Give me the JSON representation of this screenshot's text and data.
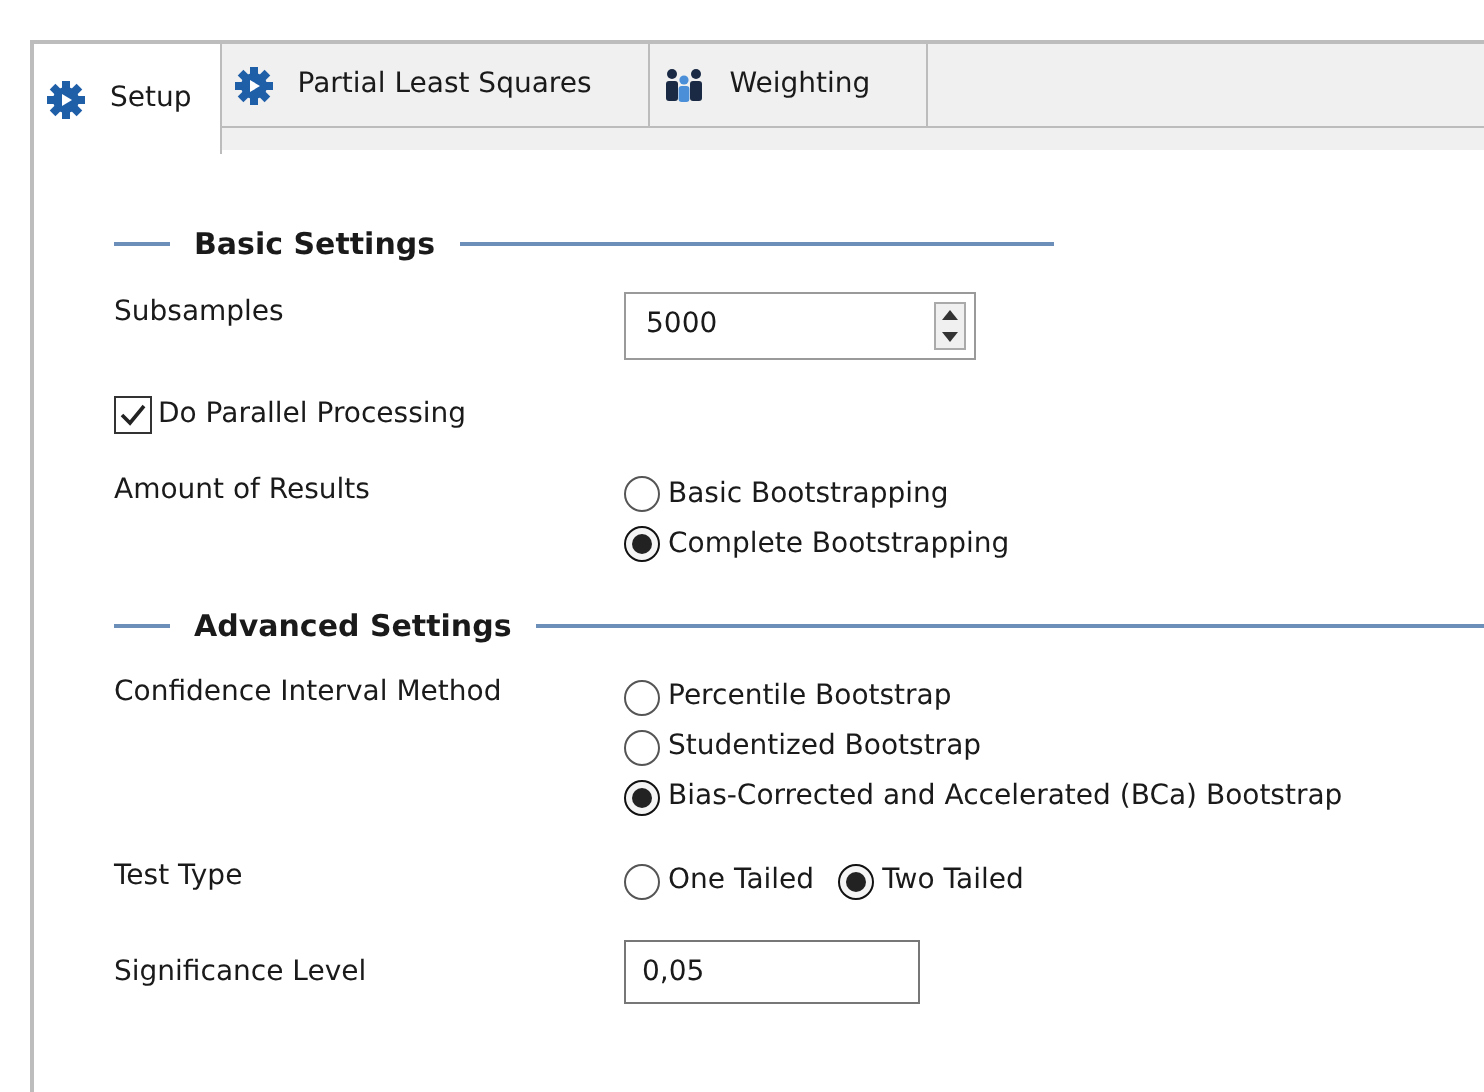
{
  "tabs": [
    {
      "label": "Setup",
      "selected": true,
      "kind": "gear"
    },
    {
      "label": "Partial Least Squares",
      "selected": false,
      "kind": "gear"
    },
    {
      "label": "Weighting",
      "selected": false,
      "kind": "people"
    }
  ],
  "sections": [
    {
      "title": "Basic Settings",
      "wide": false,
      "fields": [
        {
          "kind": "spinner",
          "label": "Subsamples",
          "value": "5000"
        },
        {
          "kind": "checkbox",
          "label": "Do Parallel Processing",
          "checked": true
        },
        {
          "kind": "radiocolumn",
          "label": "Amount of Results",
          "options": [
            {
              "label": "Basic Bootstrapping",
              "selected": false
            },
            {
              "label": "Complete Bootstrapping",
              "selected": true
            }
          ]
        }
      ]
    },
    {
      "title": "Advanced Settings",
      "wide": true,
      "fields": [
        {
          "kind": "radiocolumn",
          "label": "Confidence Interval Method",
          "options": [
            {
              "label": "Percentile Bootstrap",
              "selected": false
            },
            {
              "label": "Studentized Bootstrap",
              "selected": false
            },
            {
              "label": "Bias-Corrected and Accelerated (BCa) Bootstrap",
              "selected": true
            }
          ]
        },
        {
          "kind": "radiorow",
          "label": "Test Type",
          "options": [
            {
              "label": "One Tailed",
              "selected": false
            },
            {
              "label": "Two Tailed",
              "selected": true
            }
          ]
        },
        {
          "kind": "text",
          "label": "Significance Level",
          "value": "0,05"
        }
      ]
    }
  ]
}
